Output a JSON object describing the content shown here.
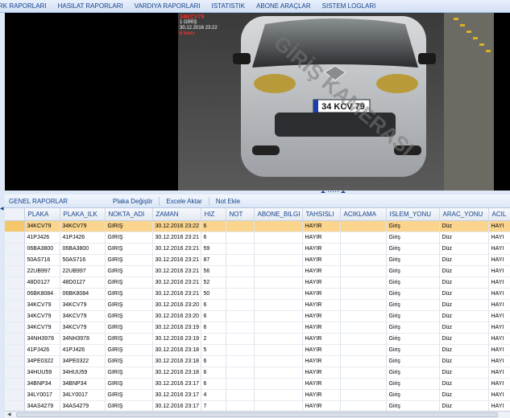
{
  "menu": [
    {
      "name": "menu-kart-raporlari",
      "label": "RK RAPORLARI"
    },
    {
      "name": "menu-hasilat-raporlari",
      "label": "HASILAT RAPORLARI"
    },
    {
      "name": "menu-vardiya-raporlari",
      "label": "VARDIYA RAPORLARI"
    },
    {
      "name": "menu-istatistik",
      "label": "ISTATISTIK"
    },
    {
      "name": "menu-abone-araclar",
      "label": "ABONE ARAÇLAR"
    },
    {
      "name": "menu-sistem-loglari",
      "label": "SISTEM LOGLARI"
    }
  ],
  "camera": {
    "plate_overlay": "34KCV79",
    "direction_overlay": "1 GİRİŞ",
    "time_overlay": "30.12.2016 23:22",
    "speed_overlay": "6 km/s",
    "plate_on_car": "34 KCV 79",
    "watermark": "GİRİŞ KAMERASI"
  },
  "toolbar": {
    "title": "GENEL RAPORLAR",
    "plate_change": "Plaka Değiştir",
    "export_excel": "Excele Aktar",
    "add_note": "Not Ekle"
  },
  "grid": {
    "columns": [
      "PLAKA",
      "PLAKA_ILK",
      "NOKTA_ADI",
      "ZAMAN",
      "HIZ",
      "NOT",
      "ABONE_BILGI",
      "TAHSISLI",
      "ACIKLAMA",
      "ISLEM_YONU",
      "ARAC_YONU",
      "ACIL"
    ],
    "rows": [
      [
        "34KCV79",
        "34KCV79",
        "GIRIŞ",
        "30.12.2016 23:22",
        "6",
        "",
        "",
        "HAYIR",
        "",
        "Giriş",
        "Düz",
        "HAYI"
      ],
      [
        "41PJ426",
        "41PJ426",
        "GIRIŞ",
        "30.12.2016 23:21",
        "6",
        "",
        "",
        "HAYIR",
        "",
        "Giriş",
        "Düz",
        "HAYI"
      ],
      [
        "06BA3800",
        "06BA3800",
        "GIRIŞ",
        "30.12.2016 23:21",
        "59",
        "",
        "",
        "HAYIR",
        "",
        "Giriş",
        "Düz",
        "HAYI"
      ],
      [
        "50AS716",
        "50AS716",
        "GIRIŞ",
        "30.12.2016 23:21",
        "87",
        "",
        "",
        "HAYIR",
        "",
        "Giriş",
        "Düz",
        "HAYI"
      ],
      [
        "22UB997",
        "22UB997",
        "GIRIŞ",
        "30.12.2016 23:21",
        "56",
        "",
        "",
        "HAYIR",
        "",
        "Giriş",
        "Düz",
        "HAYI"
      ],
      [
        "48D0127",
        "48D0127",
        "GIRIŞ",
        "30.12.2016 23:21",
        "52",
        "",
        "",
        "HAYIR",
        "",
        "Giriş",
        "Düz",
        "HAYI"
      ],
      [
        "06BK8084",
        "06BK8084",
        "GIRIŞ",
        "30.12.2016 23:21",
        "50",
        "",
        "",
        "HAYIR",
        "",
        "Giriş",
        "Düz",
        "HAYI"
      ],
      [
        "34KCV79",
        "34KCV79",
        "GIRIŞ",
        "30.12.2016 23:20",
        "6",
        "",
        "",
        "HAYIR",
        "",
        "Giriş",
        "Düz",
        "HAYI"
      ],
      [
        "34KCV79",
        "34KCV79",
        "GIRIŞ",
        "30.12.2016 23:20",
        "6",
        "",
        "",
        "HAYIR",
        "",
        "Giriş",
        "Düz",
        "HAYI"
      ],
      [
        "34KCV79",
        "34KCV79",
        "GIRIŞ",
        "30.12.2016 23:19",
        "6",
        "",
        "",
        "HAYIR",
        "",
        "Giriş",
        "Düz",
        "HAYI"
      ],
      [
        "34NH3978",
        "34NH3978",
        "GIRIŞ",
        "30.12.2016 23:19",
        "2",
        "",
        "",
        "HAYIR",
        "",
        "Giriş",
        "Düz",
        "HAYI"
      ],
      [
        "41PJ426",
        "41PJ426",
        "GIRIŞ",
        "30.12.2016 23:18",
        "5",
        "",
        "",
        "HAYIR",
        "",
        "Giriş",
        "Düz",
        "HAYI"
      ],
      [
        "34PE0322",
        "34PE0322",
        "GIRIŞ",
        "30.12.2016 23:18",
        "6",
        "",
        "",
        "HAYIR",
        "",
        "Giriş",
        "Düz",
        "HAYI"
      ],
      [
        "34HUU59",
        "34HUU59",
        "GIRIŞ",
        "30.12.2016 23:18",
        "6",
        "",
        "",
        "HAYIR",
        "",
        "Giriş",
        "Düz",
        "HAYI"
      ],
      [
        "34BNP34",
        "34BNP34",
        "GIRIŞ",
        "30.12.2016 23:17",
        "6",
        "",
        "",
        "HAYIR",
        "",
        "Giriş",
        "Düz",
        "HAYI"
      ],
      [
        "34LY0017",
        "34LY0017",
        "GIRIŞ",
        "30.12.2016 23:17",
        "4",
        "",
        "",
        "HAYIR",
        "",
        "Giriş",
        "Düz",
        "HAYI"
      ],
      [
        "34AS4279",
        "34AS4279",
        "GIRIŞ",
        "30.12.2016 23:17",
        "7",
        "",
        "",
        "HAYIR",
        "",
        "Giriş",
        "Düz",
        "HAYI"
      ]
    ]
  },
  "colors": {
    "selected_row": "#fbd58e",
    "header_text": "#15428b",
    "overlay_red": "#ff2a2a"
  }
}
